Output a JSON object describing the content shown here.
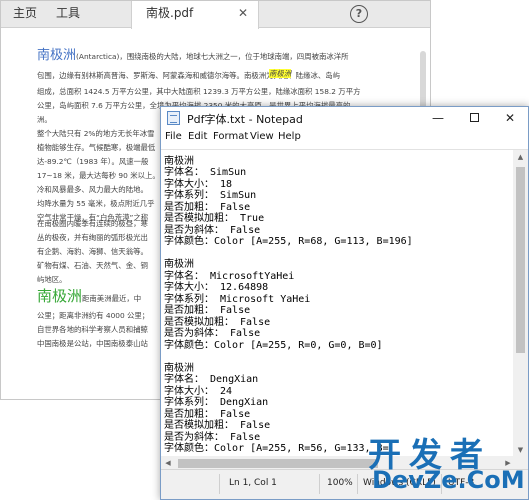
{
  "pdf_viewer": {
    "tabs": {
      "home": "主页",
      "tools": "工具",
      "doc": "南极.pdf"
    },
    "help_glyph": "?",
    "page": {
      "heading1": "南极洲",
      "para1": [
        "(Antarctica)，围绕南极的大陆，地球七大洲之一，位于地球南端，四周被南冰洋所",
        "包围，边缘有别林斯高晋海、罗斯海、阿蒙森海和威德尔海等。南极洲为大陆、陆缘冰、岛屿",
        "组成，总面积 1424.5 万平方公里，其中大陆面积 1239.3 万平方公里，陆缘冰面积 158.2 万平方",
        "公里，岛屿面积 7.6 万平方公里，全境为平均海拔 2350 米的大高原，是世界上平均海拔最高的",
        "洲。"
      ],
      "para1_highlight": "南极洲",
      "para2": [
        "整个大陆只有 2%的地方无长年冰雪",
        "植物能够生存。气候酷寒，极端最低",
        "达-89.2℃（1983 年）。风速一般",
        "17~18 米，最大达每秒 90 米以上。",
        "冷和风暴最多、风力最大的陆地。",
        "均降水量为 55 毫米，极点附近几乎",
        "空气非常干燥，有“白色荒漠”之称"
      ],
      "para3": [
        "在南极圈内暖季有连续的极昼，寒",
        "丛的极夜，并有绚丽的弧形极光出",
        "有企鹅、海豹、海狮、信天翁等。",
        "矿物有煤、石油、天然气、金、铜",
        "屿地区。"
      ],
      "heading2": "南极洲",
      "heading2_tail": "距南美洲最近，中",
      "para4": [
        "公里；距离非洲约有 4000 公里；",
        "自世界各地的科学考察人员和捕鲸",
        "中国南极是公站，中国南极泰山站"
      ]
    }
  },
  "notepad": {
    "title": "Pdf字体.txt - Notepad",
    "window_controls": {
      "minimize": "—",
      "close": "✕"
    },
    "menu": [
      "File",
      "Edit",
      "Format",
      "View",
      "Help"
    ],
    "lines": [
      "南极洲",
      "字体名： SimSun",
      "字体大小： 18",
      "字体系列： SimSun",
      "是否加粗： False",
      "是否模拟加粗： True",
      "是否为斜体： False",
      "字体颜色：Color [A=255, R=68, G=113, B=196]",
      "",
      "南极洲",
      "字体名： MicrosoftYaHei",
      "字体大小： 12.64898",
      "字体系列： Microsoft YaHei",
      "是否加粗： False",
      "是否模拟加粗： False",
      "是否为斜体： False",
      "字体颜色：Color [A=255, R=0, G=0, B=0]",
      "",
      "南极洲",
      "字体名： DengXian",
      "字体大小： 24",
      "字体系列： DengXian",
      "是否加粗： False",
      "是否模拟加粗： False",
      "是否为斜体： False",
      "字体颜色：Color [A=255, R=56, G=133, B=",
      ""
    ],
    "status": {
      "position": "Ln 1, Col 1",
      "zoom": "100%",
      "line_ending": "Windows (CRLF)",
      "encoding": "UTF-8"
    }
  },
  "watermark": {
    "cn": "开发者",
    "en": "DevZe.CoM"
  },
  "colors": {
    "heading_blue": "#4472c4",
    "heading_green": "#38a838",
    "highlight": "#ffff33",
    "watermark": "#1a6fb6"
  },
  "icons": {
    "help": "help-circle-icon",
    "notepad_app": "notepad-app-icon",
    "scroll_up": "arrow-up-icon",
    "scroll_down": "arrow-down-icon",
    "scroll_left": "arrow-left-icon",
    "scroll_right": "arrow-right-icon"
  }
}
